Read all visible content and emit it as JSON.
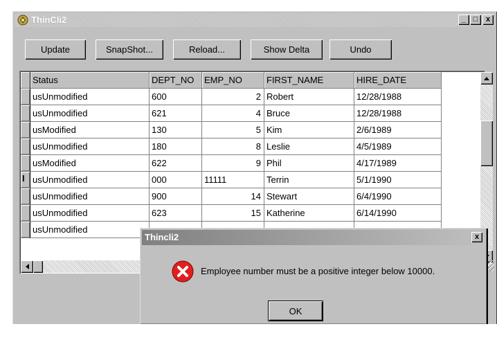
{
  "window": {
    "title": "ThinCli2",
    "minimize_glyph": "_",
    "maximize_glyph": "□",
    "close_glyph": "x"
  },
  "toolbar": {
    "update": "Update",
    "snapshot": "SnapShot...",
    "reload": "Reload...",
    "show_delta": "Show Delta",
    "undo": "Undo"
  },
  "grid": {
    "columns": [
      "Status",
      "DEPT_NO",
      "EMP_NO",
      "FIRST_NAME",
      "HIRE_DATE"
    ],
    "rows": [
      {
        "status": "usUnmodified",
        "dept_no": "600",
        "emp_no": "2",
        "first_name": "Robert",
        "hire_date": "12/28/1988"
      },
      {
        "status": "usUnmodified",
        "dept_no": "621",
        "emp_no": "4",
        "first_name": "Bruce",
        "hire_date": "12/28/1988"
      },
      {
        "status": "usModified",
        "dept_no": "130",
        "emp_no": "5",
        "first_name": "Kim",
        "hire_date": "2/6/1989"
      },
      {
        "status": "usUnmodified",
        "dept_no": "180",
        "emp_no": "8",
        "first_name": "Leslie",
        "hire_date": "4/5/1989"
      },
      {
        "status": "usModified",
        "dept_no": "622",
        "emp_no": "9",
        "first_name": "Phil",
        "hire_date": "4/17/1989"
      },
      {
        "status": "usUnmodified",
        "dept_no": "000",
        "emp_no": "11111",
        "first_name": "Terrin",
        "hire_date": "5/1/1990"
      },
      {
        "status": "usUnmodified",
        "dept_no": "900",
        "emp_no": "14",
        "first_name": "Stewart",
        "hire_date": "6/4/1990"
      },
      {
        "status": "usUnmodified",
        "dept_no": "623",
        "emp_no": "15",
        "first_name": "Katherine",
        "hire_date": "6/14/1990"
      },
      {
        "status": "usUnmodified",
        "dept_no": "",
        "emp_no": "",
        "first_name": "",
        "hire_date": ""
      }
    ],
    "editing_indicator": "I"
  },
  "dialog": {
    "title": "Thincli2",
    "close_glyph": "x",
    "message": "Employee number must be a positive integer below 10000.",
    "ok_label": "OK"
  }
}
